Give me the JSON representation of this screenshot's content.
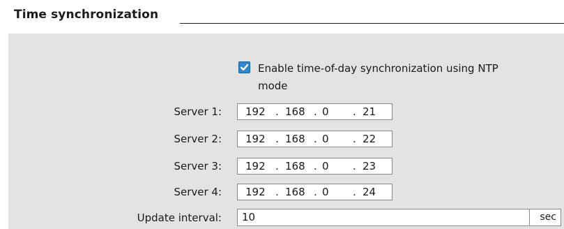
{
  "section": {
    "title": "Time synchronization"
  },
  "ntp": {
    "enabled": true,
    "label": "Enable time-of-day synchronization using NTP mode"
  },
  "servers": [
    {
      "label": "Server 1:",
      "octets": [
        "192",
        "168",
        "0",
        "21"
      ]
    },
    {
      "label": "Server 2:",
      "octets": [
        "192",
        "168",
        "0",
        "22"
      ]
    },
    {
      "label": "Server 3:",
      "octets": [
        "192",
        "168",
        "0",
        "23"
      ]
    },
    {
      "label": "Server 4:",
      "octets": [
        "192",
        "168",
        "0",
        "24"
      ]
    }
  ],
  "update_interval": {
    "label": "Update interval:",
    "value": "10",
    "unit": "sec"
  },
  "colors": {
    "panel_background": "#e3e3e3",
    "checkbox_accent": "#2f86cf"
  }
}
